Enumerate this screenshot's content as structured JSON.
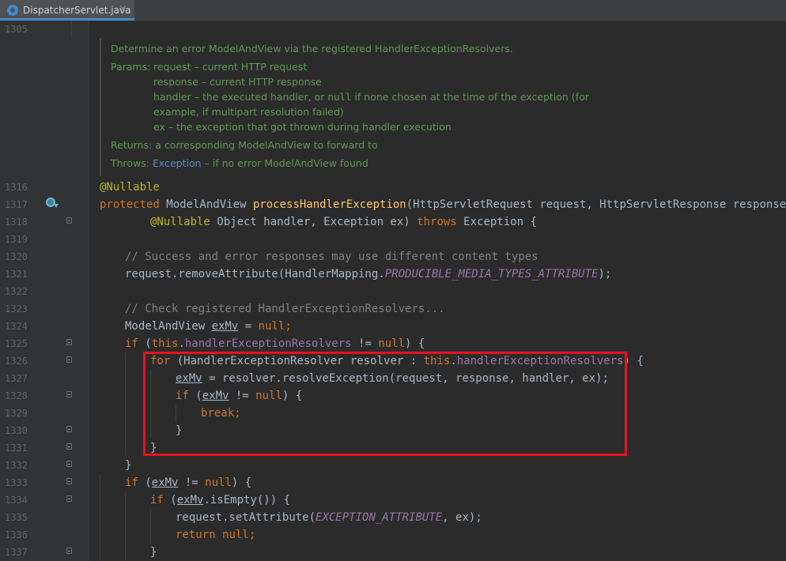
{
  "tab": {
    "filename": "DispatcherServlet.java",
    "close": "×"
  },
  "first_line_number": "1305",
  "doc": {
    "summary": "Determine an error ModelAndView via the registered HandlerExceptionResolvers.",
    "params_label": "Params:",
    "params": [
      "request – current HTTP request",
      "response – current HTTP response",
      "handler – the executed handler, or",
      "null",
      "if none chosen at the time of the exception (for",
      "example, if multipart resolution failed)",
      "ex – the exception that got thrown during handler execution"
    ],
    "returns_label": "Returns:",
    "returns": "a corresponding ModelAndView to forward to",
    "throws_label": "Throws:",
    "throws_type": "Exception",
    "throws_text": "– if no error ModelAndView found"
  },
  "line_numbers": [
    "1316",
    "1317",
    "1318",
    "1319",
    "1320",
    "1321",
    "1322",
    "1323",
    "1324",
    "1325",
    "1326",
    "1327",
    "1328",
    "1329",
    "1330",
    "1331",
    "1332",
    "1333",
    "1334",
    "1335",
    "1336",
    "1337"
  ],
  "code": {
    "l1316": {
      "annotation": "@Nullable"
    },
    "l1317": {
      "kw": "protected",
      "type": " ModelAndView ",
      "method": "processHandlerException",
      "rest": "(HttpServletRequest request, HttpServletResponse response,"
    },
    "l1318": {
      "annotation": "@Nullable",
      "mid": " Object handler, Exception ex) ",
      "kw": "throws",
      "rest": " Exception {"
    },
    "l1320": {
      "comment": "// Success and error responses may use different content types"
    },
    "l1321": {
      "pre": "request.removeAttribute(HandlerMapping.",
      "const": "PRODUCIBLE_MEDIA_TYPES_ATTRIBUTE",
      "post": ");"
    },
    "l1323": {
      "comment": "// Check registered HandlerExceptionResolvers..."
    },
    "l1324": {
      "pre": "ModelAndView ",
      "var": "exMv",
      "mid": " = ",
      "kw": "null",
      "post": ";"
    },
    "l1325": {
      "kw1": "if",
      "pre": " (",
      "kw2": "this",
      "dot": ".",
      "field": "handlerExceptionResolvers",
      "mid": " != ",
      "kw3": "null",
      "post": ") {"
    },
    "l1326": {
      "kw1": "for",
      "pre": " (HandlerExceptionResolver resolver : ",
      "kw2": "this",
      "dot": ".",
      "field": "handlerExceptionResolvers",
      "post": ") {"
    },
    "l1327": {
      "var": "exMv",
      "rest": " = resolver.resolveException(request, response, handler, ex);"
    },
    "l1328": {
      "kw1": "if",
      "pre": " (",
      "var": "exMv",
      "mid": " != ",
      "kw2": "null",
      "post": ") {"
    },
    "l1329": {
      "kw": "break",
      "post": ";"
    },
    "l1330": {
      "text": "}"
    },
    "l1331": {
      "text": "}"
    },
    "l1332": {
      "text": "}"
    },
    "l1333": {
      "kw1": "if",
      "pre": " (",
      "var": "exMv",
      "mid": " != ",
      "kw2": "null",
      "post": ") {"
    },
    "l1334": {
      "kw1": "if",
      "pre": " (",
      "var": "exMv",
      "post": ".isEmpty()) {"
    },
    "l1335": {
      "pre": "request.setAttribute(",
      "const": "EXCEPTION_ATTRIBUTE",
      "post": ", ex);"
    },
    "l1336": {
      "kw1": "return",
      "mid": " ",
      "kw2": "null",
      "post": ";"
    },
    "l1337": {
      "text": "}"
    }
  }
}
